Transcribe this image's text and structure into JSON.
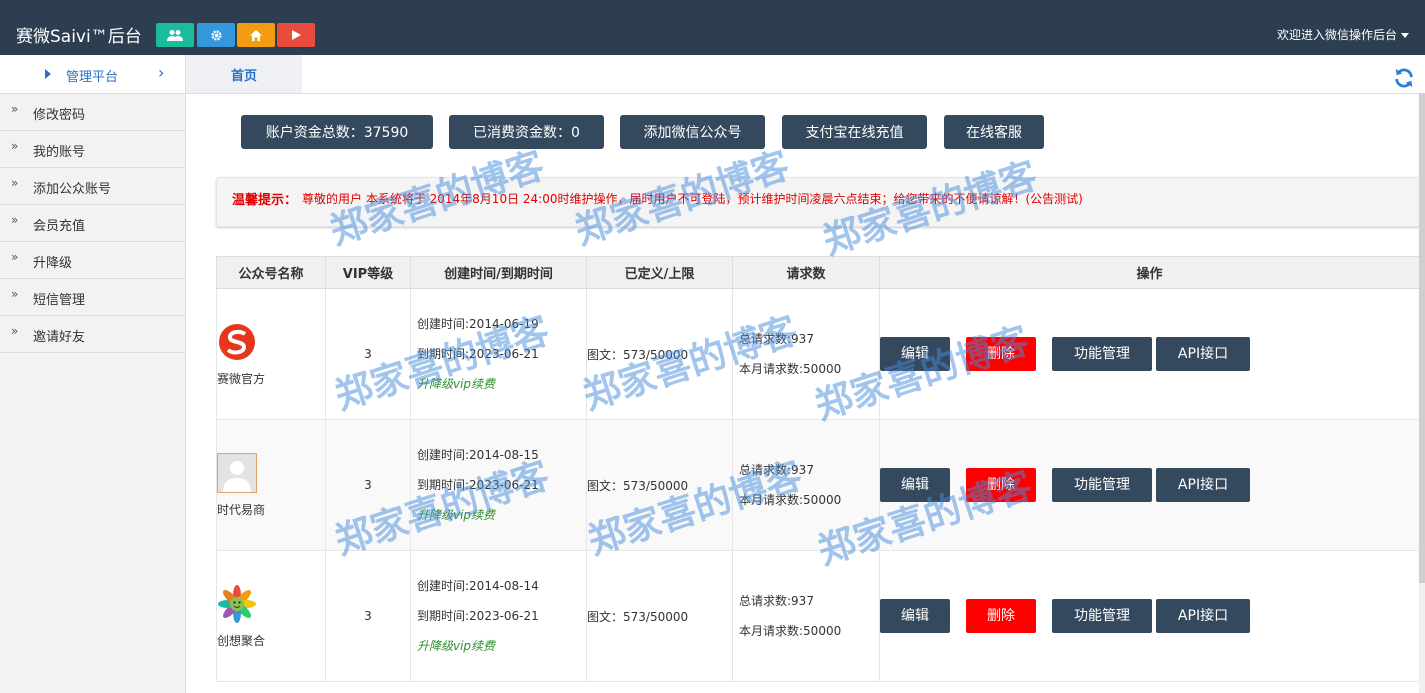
{
  "header": {
    "brand": "赛微Saivi™后台",
    "quick_buttons": [
      {
        "icon": "users-icon",
        "color": "#1abc9c"
      },
      {
        "icon": "gear-icon",
        "color": "#3498db"
      },
      {
        "icon": "home-icon",
        "color": "#f39c12"
      },
      {
        "icon": "play-icon",
        "color": "#e74c3c"
      }
    ],
    "welcome": "欢迎进入微信操作后台"
  },
  "sidebar": {
    "title": "管理平台",
    "items": [
      {
        "label": "修改密码"
      },
      {
        "label": "我的账号"
      },
      {
        "label": "添加公众账号"
      },
      {
        "label": "会员充值"
      },
      {
        "label": "升降级"
      },
      {
        "label": "短信管理"
      },
      {
        "label": "邀请好友"
      }
    ]
  },
  "tabs": {
    "home": "首页"
  },
  "summary_buttons": [
    {
      "label": "账户资金总数：37590"
    },
    {
      "label": "已消费资金数：0"
    },
    {
      "label": "添加微信公众号"
    },
    {
      "label": "支付宝在线充值"
    },
    {
      "label": "在线客服"
    }
  ],
  "notice": {
    "label": "温馨提示：",
    "text": "尊敬的用户 本系统将于 2014年8月10日 24:00时维护操作，届时用户不可登陆，预计维护时间凌晨六点结束；给您带来的不便请谅解！(公告测试)"
  },
  "table": {
    "columns": [
      "公众号名称",
      "VIP等级",
      "创建时间/到期时间",
      "已定义/上限",
      "请求数",
      "操作"
    ],
    "rows": [
      {
        "name": "赛微官方",
        "logo": "saivi-logo-icon",
        "vip": "3",
        "created": "创建时间:2014-06-19",
        "expires": "到期时间:2023-06-21",
        "renew": "升降级vip续费",
        "quota": "图文：573/50000",
        "total_req": "总请求数:937",
        "month_req": "本月请求数:50000"
      },
      {
        "name": "时代易商",
        "logo": "default-avatar-icon",
        "vip": "3",
        "created": "创建时间:2014-08-15",
        "expires": "到期时间:2023-06-21",
        "renew": "升降级vip续费",
        "quota": "图文：573/50000",
        "total_req": "总请求数:937",
        "month_req": "本月请求数:50000"
      },
      {
        "name": "创想聚合",
        "logo": "flower-logo-icon",
        "vip": "3",
        "created": "创建时间:2014-08-14",
        "expires": "到期时间:2023-06-21",
        "renew": "升降级vip续费",
        "quota": "图文：573/50000",
        "total_req": "总请求数:937",
        "month_req": "本月请求数:50000"
      }
    ],
    "actions": {
      "edit": "编辑",
      "delete": "删除",
      "features": "功能管理",
      "api": "API接口"
    }
  },
  "watermark": "郑家喜的博客"
}
